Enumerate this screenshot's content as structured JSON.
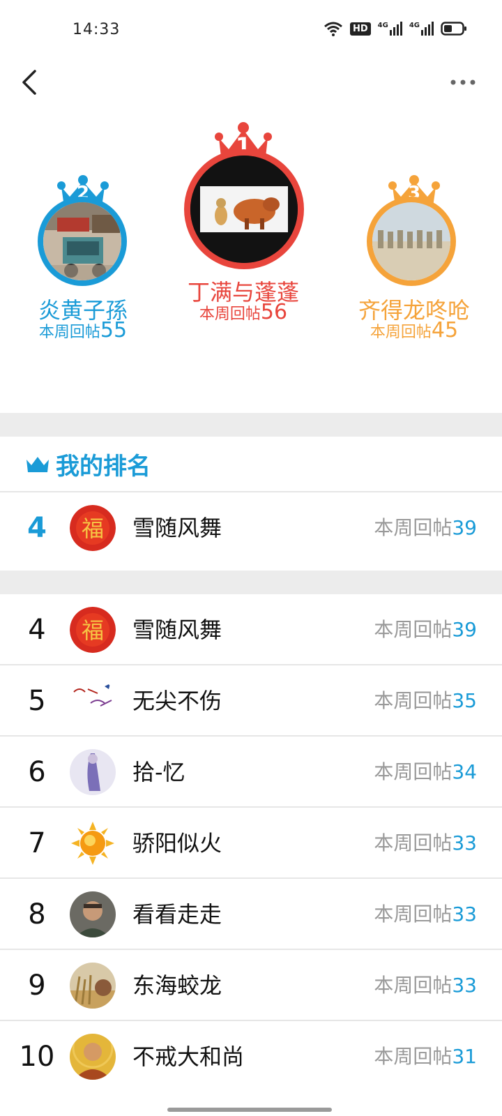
{
  "status_bar": {
    "time": "14:33",
    "hd_label": "HD",
    "net1": "4G",
    "net2": "4G"
  },
  "nav": {
    "back_icon": "chevron-left-icon",
    "more_icon": "more-horizontal-icon"
  },
  "podium": {
    "first": {
      "rank": "1",
      "name": "丁满与蓬蓬",
      "stat_label": "本周回帖",
      "count": "56",
      "color": "#e8453c"
    },
    "second": {
      "rank": "2",
      "name": "炎黄子孫",
      "stat_label": "本周回帖",
      "count": "55",
      "color": "#1a9bd7"
    },
    "third": {
      "rank": "3",
      "name": "齐得龙咚呛",
      "stat_label": "本周回帖",
      "count": "45",
      "color": "#f5a33a"
    }
  },
  "my_rank": {
    "title": "我的排名",
    "icon": "crown-icon",
    "entry": {
      "rank": "4",
      "name": "雪随风舞",
      "stat_label": "本周回帖",
      "count": "39"
    }
  },
  "list": [
    {
      "rank": "4",
      "name": "雪随风舞",
      "stat_label": "本周回帖",
      "count": "39"
    },
    {
      "rank": "5",
      "name": "无尖不伤",
      "stat_label": "本周回帖",
      "count": "35"
    },
    {
      "rank": "6",
      "name": "拾-忆",
      "stat_label": "本周回帖",
      "count": "34"
    },
    {
      "rank": "7",
      "name": "骄阳似火",
      "stat_label": "本周回帖",
      "count": "33"
    },
    {
      "rank": "8",
      "name": "看看走走",
      "stat_label": "本周回帖",
      "count": "33"
    },
    {
      "rank": "9",
      "name": "东海蛟龙",
      "stat_label": "本周回帖",
      "count": "33"
    },
    {
      "rank": "10",
      "name": "不戒大和尚",
      "stat_label": "本周回帖",
      "count": "31"
    }
  ],
  "colors": {
    "accent": "#1a9bd7",
    "gold": "#f5a33a",
    "red": "#e8453c"
  }
}
